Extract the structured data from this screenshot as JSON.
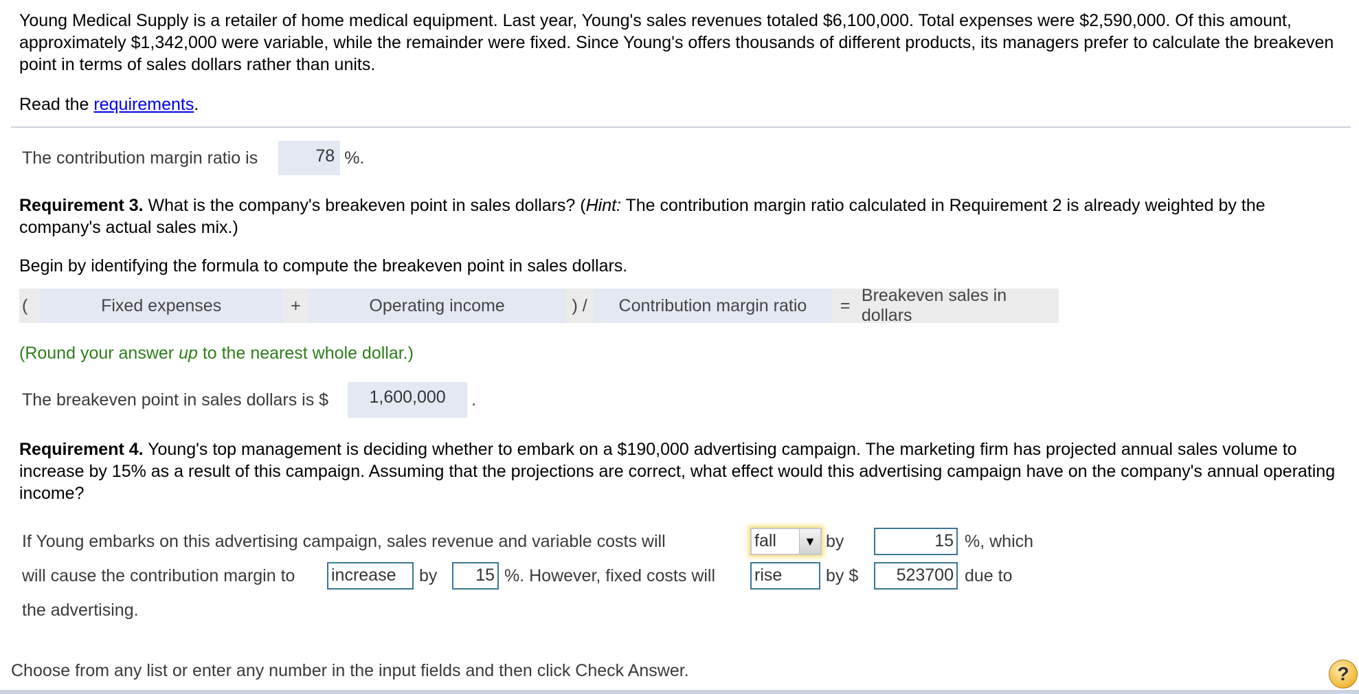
{
  "intro": {
    "text": "Young Medical Supply is a retailer of home medical equipment. Last year, Young's sales revenues totaled $6,100,000. Total expenses were $2,590,000. Of this amount, approximately $1,342,000 were variable, while the remainder were fixed. Since Young's offers thousands of different products, its managers prefer to calculate the breakeven point in terms of sales dollars rather than units."
  },
  "read": {
    "prefix": "Read the ",
    "link": "requirements",
    "suffix": "."
  },
  "cm_ratio": {
    "label": "The contribution margin ratio is",
    "value": "78",
    "suffix": "%."
  },
  "req3": {
    "title": "Requirement 3.",
    "text_a": " What is the company's breakeven point in sales dollars? (",
    "hint_label": "Hint:",
    "text_b": " The contribution margin ratio calculated in Requirement 2 is already weighted by the company's actual sales mix.)"
  },
  "begin": "Begin by identifying the formula to compute the breakeven point in sales dollars.",
  "formula": {
    "open": "(",
    "term1": "Fixed expenses",
    "plus": "+",
    "term2": "Operating income",
    "divide": ") /",
    "term3": "Contribution margin ratio",
    "equals": "=",
    "result": "Breakeven sales in dollars"
  },
  "round_note": {
    "a": "(Round your answer ",
    "em": "up",
    "b": " to the nearest whole dollar.)"
  },
  "breakeven": {
    "label": "The breakeven point in sales dollars is $",
    "value": "1,600,000",
    "suffix": "."
  },
  "req4": {
    "title": "Requirement 4.",
    "text": " Young's top management is deciding whether to embark on a $190,000 advertising campaign. The marketing firm has projected annual sales volume to increase by 15% as a result of this campaign. Assuming that the projections are correct, what effect would this advertising campaign have on the company's annual operating income?"
  },
  "answer": {
    "line1": "If Young embarks on this advertising campaign, sales revenue and variable costs will",
    "select_value": "fall",
    "by1": "by",
    "pct1": "15",
    "which": "%, which",
    "line2": "will cause the contribution margin to",
    "cm_direction": "increase",
    "by2": "by",
    "pct2": "15",
    "however": "%. However, fixed costs will",
    "fixed_direction": "rise",
    "by3": "by $",
    "fixed_amount": "523700",
    "due_to": "due to",
    "line3": "the advertising."
  },
  "footer": {
    "instruction": "Choose from any list or enter any number in the input fields and then click Check Answer.",
    "help_icon": "?"
  }
}
